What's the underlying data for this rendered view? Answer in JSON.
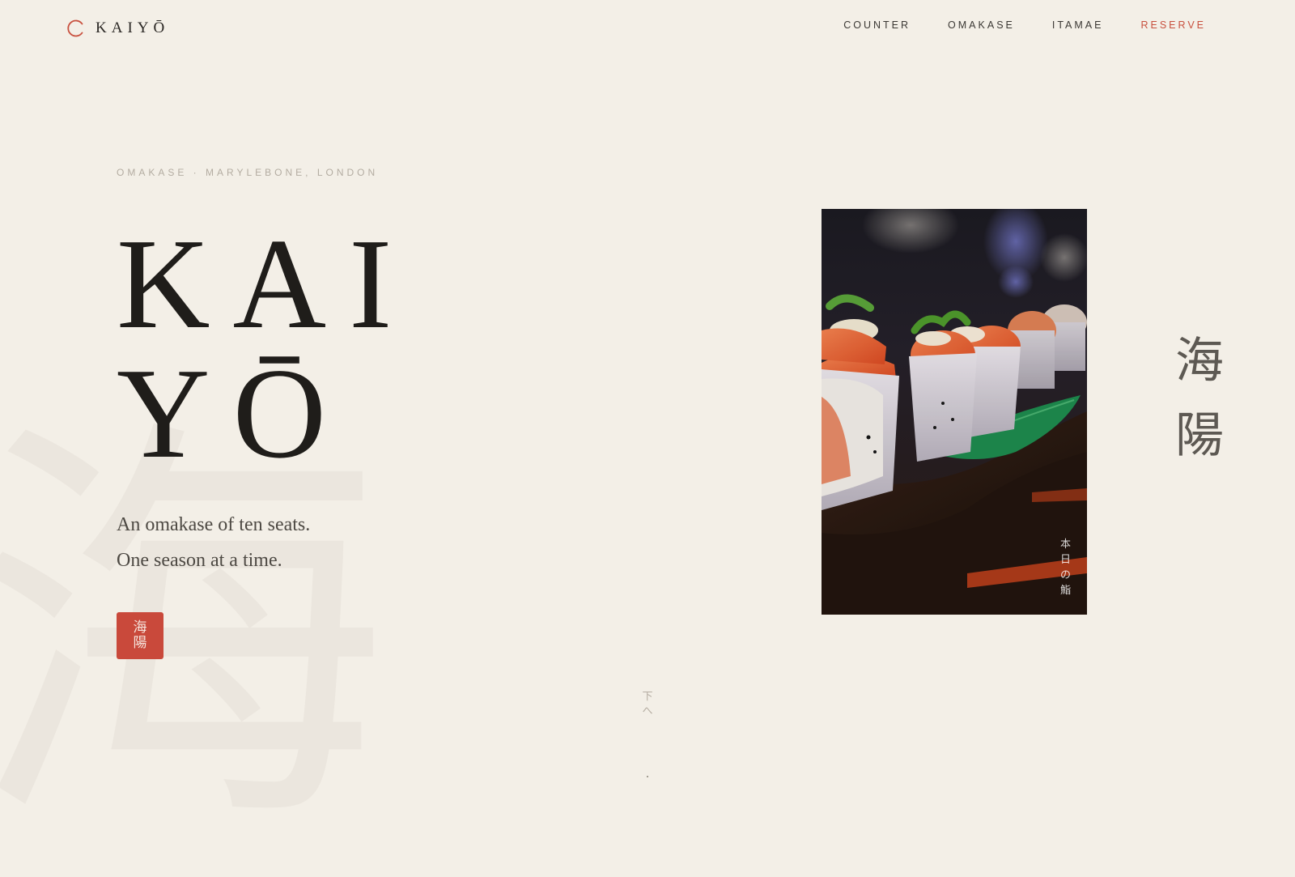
{
  "header": {
    "logo_text": "KAIYŌ",
    "nav": [
      {
        "label": "COUNTER"
      },
      {
        "label": "OMAKASE"
      },
      {
        "label": "ITAMAE"
      },
      {
        "label": "RESERVE"
      }
    ]
  },
  "hero": {
    "eyebrow": "OMAKASE · MARYLEBONE, LONDON",
    "title_line_1": "KAI",
    "title_line_2": "YŌ",
    "tagline_1": "An omakase of ten seats.",
    "tagline_2": "One season at a time.",
    "stamp_char_1": "海",
    "stamp_char_2": "陽",
    "background_char": "海"
  },
  "photo": {
    "caption_chars": [
      "本",
      "日",
      "の",
      "鮨"
    ]
  },
  "side": {
    "char_1": "海",
    "char_2": "陽"
  },
  "scroll_cue": {
    "char_1": "下",
    "char_2": "へ"
  },
  "colors": {
    "background": "#f3efe7",
    "accent": "#c8503e",
    "ink": "#1f1d1a"
  },
  "icons": {
    "logo_mark": "crescent-ring-icon"
  }
}
